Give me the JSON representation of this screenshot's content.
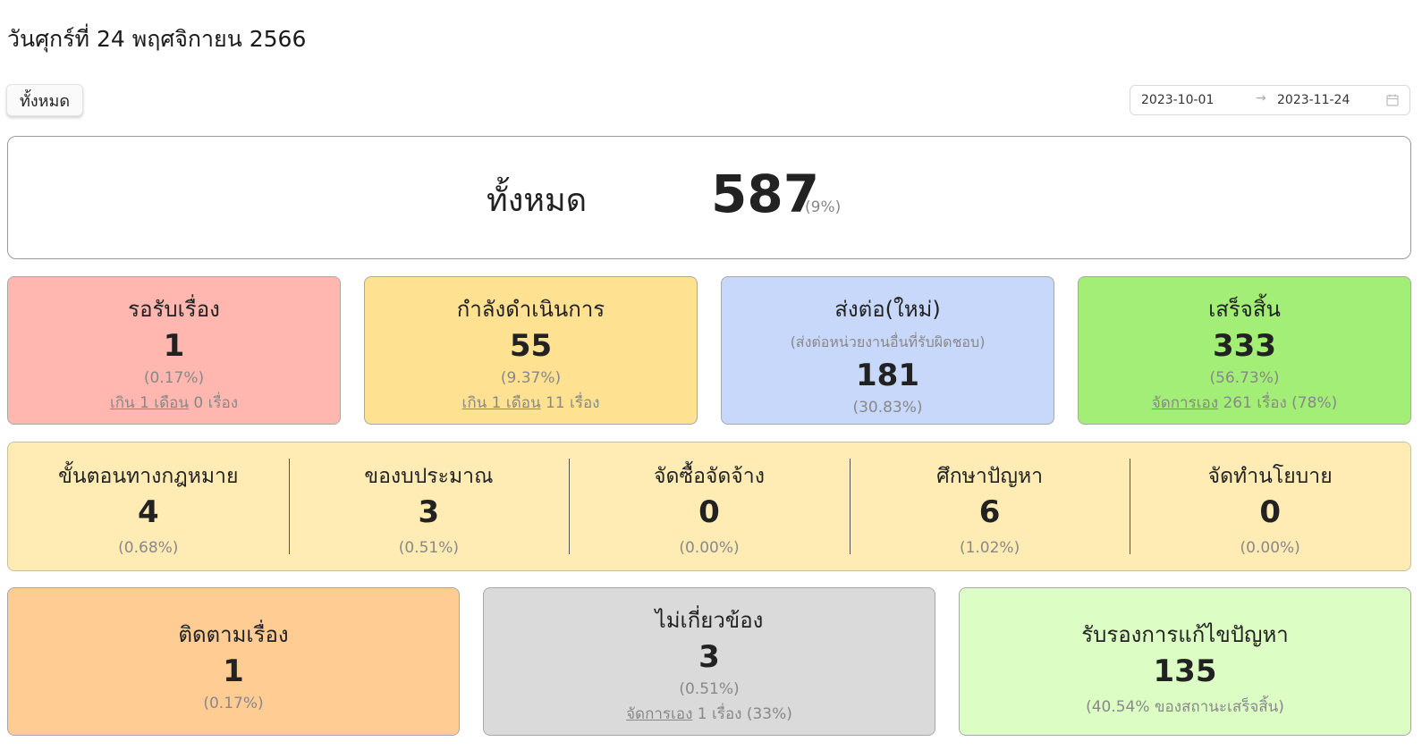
{
  "header": {
    "date": "วันศุกร์ที่ 24 พฤศจิกายน 2566"
  },
  "filter": {
    "all_label": "ทั้งหมด"
  },
  "date_range": {
    "start": "2023-10-01",
    "separator": "→",
    "end": "2023-11-24"
  },
  "total": {
    "label": "ทั้งหมด",
    "value": "587",
    "percent": "(9%)"
  },
  "status": {
    "waiting": {
      "title": "รอรับเรื่อง",
      "value": "1",
      "percent": "(0.17%)",
      "link": "เกิน 1 เดือน",
      "link_suffix": " 0 เรื่อง",
      "color": "#ffb7b0"
    },
    "in_progress": {
      "title": "กำลังดำเนินการ",
      "value": "55",
      "percent": "(9.37%)",
      "link": "เกิน 1 เดือน",
      "link_suffix": " 11 เรื่อง",
      "color": "#ffe291"
    },
    "forwarded": {
      "title": "ส่งต่อ(ใหม่)",
      "subtitle": "(ส่งต่อหน่วยงานอื่นที่รับผิดชอบ)",
      "value": "181",
      "percent": "(30.83%)",
      "color": "#c8d8fb"
    },
    "completed": {
      "title": "เสร็จสิ้น",
      "value": "333",
      "percent": "(56.73%)",
      "link": "จัดการเอง",
      "link_suffix": " 261 เรื่อง (78%)",
      "color": "#a2ee77"
    }
  },
  "categories": [
    {
      "title": "ขั้นตอนทางกฎหมาย",
      "value": "4",
      "percent": "(0.68%)"
    },
    {
      "title": "ของบประมาณ",
      "value": "3",
      "percent": "(0.51%)"
    },
    {
      "title": "จัดซื้อจัดจ้าง",
      "value": "0",
      "percent": "(0.00%)"
    },
    {
      "title": "ศึกษาปัญหา",
      "value": "6",
      "percent": "(1.02%)"
    },
    {
      "title": "จัดทำนโยบาย",
      "value": "0",
      "percent": "(0.00%)"
    }
  ],
  "extra": {
    "follow_up": {
      "title": "ติดตามเรื่อง",
      "value": "1",
      "percent": "(0.17%)",
      "color": "#ffcc94"
    },
    "unrelated": {
      "title": "ไม่เกี่ยวข้อง",
      "value": "3",
      "percent": "(0.51%)",
      "link": "จัดการเอง",
      "link_suffix": " 1 เรื่อง (33%)",
      "color": "#dadada"
    },
    "certified": {
      "title": "รับรองการแก้ไขปัญหา",
      "value": "135",
      "percent": "(40.54% ของสถานะเสร็จสิ้น)",
      "color": "#dcfdc4"
    }
  }
}
